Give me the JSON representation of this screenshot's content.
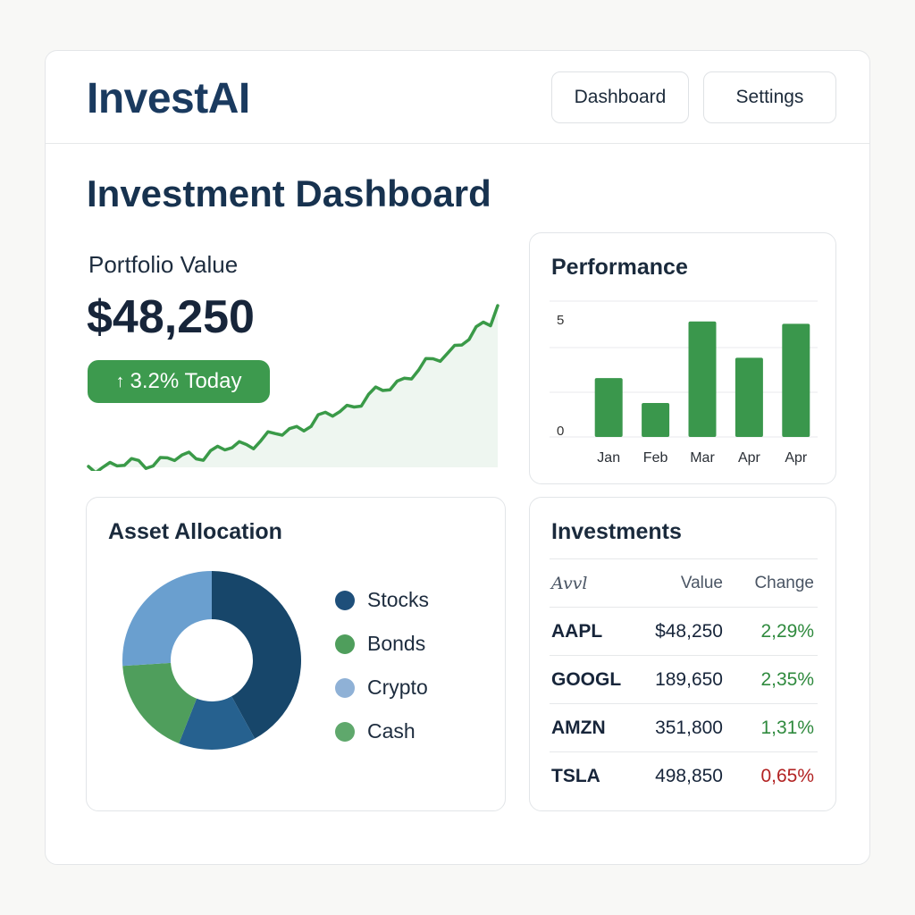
{
  "header": {
    "logo": "InvestAI",
    "nav": [
      {
        "label": "Dashboard"
      },
      {
        "label": "Settings"
      }
    ]
  },
  "page": {
    "title": "Investment Dashboard"
  },
  "portfolio": {
    "label": "Portfolio Value",
    "value": "$48,250",
    "badge": "3.2% Today",
    "badge_icon": "arrow-up-icon",
    "trend_color": "#3a9a48"
  },
  "performance": {
    "title": "Performance",
    "chart_data": {
      "type": "bar",
      "categories": [
        "Jan",
        "Feb",
        "Mar",
        "Apr",
        "Apr"
      ],
      "values": [
        2.6,
        1.5,
        5.1,
        3.5,
        5.0
      ],
      "ylim": [
        0,
        6
      ],
      "y_ticks": [
        "5",
        "0"
      ],
      "grid": true,
      "bar_color": "#3a974c"
    }
  },
  "allocation": {
    "title": "Asset Allocation",
    "chart_data": {
      "type": "pie",
      "style": "donut",
      "slices": [
        {
          "label": "Stocks",
          "value": 42,
          "color": "#17466a"
        },
        {
          "label": "Bonds",
          "value": 14,
          "color": "#26618f"
        },
        {
          "label": "Crypto",
          "value": 18,
          "color": "#4f9e5c"
        },
        {
          "label": "Cash",
          "value": 26,
          "color": "#6a9fcf"
        }
      ]
    },
    "legend": [
      {
        "label": "Stocks",
        "color": "#1e4f7a"
      },
      {
        "label": "Bonds",
        "color": "#4f9e5c"
      },
      {
        "label": "Crypto",
        "color": "#8fb1d6"
      },
      {
        "label": "Cash",
        "color": "#5fa86c"
      }
    ]
  },
  "investments": {
    "title": "Investments",
    "columns": [
      "Avvl",
      "Value",
      "Change"
    ],
    "rows": [
      {
        "symbol": "AAPL",
        "value": "$48,250",
        "change": "2,29%",
        "trend": "pos"
      },
      {
        "symbol": "GOOGL",
        "value": "189,650",
        "change": "2,35%",
        "trend": "pos"
      },
      {
        "symbol": "AMZN",
        "value": "351,800",
        "change": "1,31%",
        "trend": "pos"
      },
      {
        "symbol": "TSLA",
        "value": "498,850",
        "change": "0,65%",
        "trend": "neg"
      }
    ]
  }
}
